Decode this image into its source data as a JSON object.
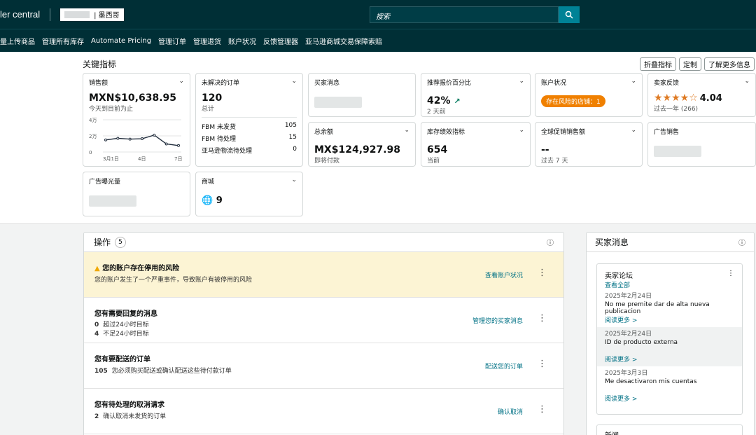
{
  "header": {
    "brand": "ler central",
    "account_name": "| 墨西哥",
    "search_placeholder": "搜索"
  },
  "nav": [
    "量上传商品",
    "管理所有库存",
    "Automate Pricing",
    "管理订单",
    "管理退货",
    "账户状况",
    "反馈管理器",
    "亚马逊商城交易保障索赔"
  ],
  "metrics": {
    "title": "关键指标",
    "buttons": [
      "折叠指标",
      "定制",
      "了解更多信息"
    ],
    "sales": {
      "label": "销售额",
      "value": "MXN$10,638.95",
      "sub": "今天到目前为止",
      "y_ticks": [
        "4万",
        "2万",
        "0"
      ],
      "x_ticks": [
        "3月1日",
        "4日",
        "7日"
      ]
    },
    "orders": {
      "label": "未解决的订单",
      "value": "120",
      "sub": "总计",
      "rows": [
        {
          "label": "FBM 未发货",
          "value": "105"
        },
        {
          "label": "FBM 待处理",
          "value": "15"
        },
        {
          "label": "亚马逊物流待处理",
          "value": "0"
        }
      ]
    },
    "buyer_msgs": {
      "label": "买家消息"
    },
    "featured_offer": {
      "label": "推荐报价百分比",
      "value": "42%",
      "sub": "2 天前"
    },
    "account_health": {
      "label": "账户状况",
      "pill": "存在风险的店铺：1"
    },
    "feedback": {
      "label": "卖家反馈",
      "stars": "★★★★☆",
      "rating": "4.04",
      "sub": "过去一年 (266)"
    },
    "balance": {
      "label": "总余额",
      "value": "MX$124,927.98",
      "sub": "即将付款"
    },
    "inventory": {
      "label": "库存绩效指标",
      "value": "654",
      "sub": "当前"
    },
    "global_sales": {
      "label": "全球促销销售额",
      "value": "--",
      "sub": "过去 7 天"
    },
    "ad_sales": {
      "label": "广告销售"
    },
    "ad_impressions": {
      "label": "广告曝光量"
    },
    "marketplaces": {
      "label": "商城",
      "value": "9"
    }
  },
  "chart_data": {
    "type": "line",
    "x": [
      "3月1日",
      "",
      "",
      "4日",
      "",
      "",
      "7日"
    ],
    "values": [
      15000,
      17000,
      16000,
      16500,
      21000,
      10000,
      8000
    ],
    "ylim": [
      0,
      40000
    ]
  },
  "operations": {
    "title": "操作",
    "count": "5",
    "rows": [
      {
        "title": "您的账户存在停用的风险",
        "desc": "您的账户发生了一个严重事件，导致账户有被停用的风险",
        "action": "查看账户状况"
      },
      {
        "title": "您有需要回复的消息",
        "line1_num": "0",
        "line1": "超过24小时目标",
        "line2_num": "4",
        "line2": "不足24小时目标",
        "action": "管理您的买家消息"
      },
      {
        "title": "您有要配送的订单",
        "num": "105",
        "desc": "您必须购买配送或确认配送这些待付款订单",
        "action": "配送您的订单"
      },
      {
        "title": "您有待处理的取消请求",
        "num": "2",
        "desc": "确认取消未发货的订单",
        "action": "确认取消"
      }
    ]
  },
  "buyer_messages": {
    "title": "买家消息",
    "forum_title": "卖家论坛",
    "view_all": "查看全部",
    "posts": [
      {
        "date": "2025年2月24日",
        "title": "No me premite dar de alta nueva publicacion",
        "link": "阅读更多 >"
      },
      {
        "date": "2025年2月24日",
        "title": "ID de producto externa",
        "link": "阅读更多 >"
      },
      {
        "date": "2025年3月3日",
        "title": "Me desactivaron mis cuentas",
        "link": "阅读更多 >"
      }
    ],
    "next_card": "新闻"
  }
}
